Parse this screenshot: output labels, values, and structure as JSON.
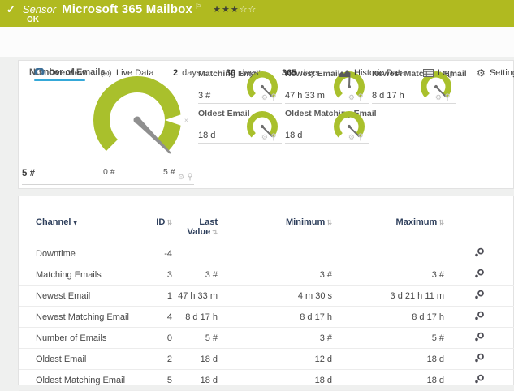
{
  "colors": {
    "header_green": "#b0ba20",
    "gauge_green": "#a9c02c",
    "active_tab_blue": "#35a8d8",
    "table_header_text": "#2e3f5c"
  },
  "icons": {
    "check": "✓",
    "flag": "⚐",
    "stars_filled": "★★★",
    "stars_empty": "☆☆",
    "gear": "⚙",
    "sort": "⇅",
    "sort_desc": "▾",
    "limit_marker": "×"
  },
  "header": {
    "kind_label": "Sensor",
    "title": "Microsoft 365 Mailbox",
    "status": "OK",
    "rating_filled_count": 3,
    "rating_total": 5
  },
  "tabs": {
    "overview": "Overview",
    "live_data": "Live Data",
    "d2_num": "2",
    "d2_label": "days",
    "d30_num": "30",
    "d30_label": "days",
    "d365_num": "365",
    "d365_label": "days",
    "historic": "Historic Data",
    "log": "Log",
    "settings": "Settings"
  },
  "overview": {
    "main_gauge": {
      "title": "Number of Emails",
      "value": "5 #",
      "scale_min": "0 #",
      "scale_max": "5 #",
      "needle_deg": 135
    },
    "gauges": [
      {
        "title": "Matching Emails",
        "value": "3 #",
        "needle_deg": 135
      },
      {
        "title": "Newest Email",
        "value": "47 h 33 m",
        "needle_deg": 2
      },
      {
        "title": "Newest Matching Email",
        "value": "8 d 17 h",
        "needle_deg": 135
      },
      {
        "title": "Oldest Email",
        "value": "18 d",
        "needle_deg": 135
      },
      {
        "title": "Oldest Matching Email",
        "value": "18 d",
        "needle_deg": 135
      }
    ]
  },
  "table": {
    "headers": {
      "channel": "Channel",
      "id": "ID",
      "last_line1": "Last",
      "last_line2": "Value",
      "min": "Minimum",
      "max": "Maximum"
    },
    "rows": [
      {
        "channel": "Downtime",
        "id": "-4",
        "last": "",
        "min": "",
        "max": ""
      },
      {
        "channel": "Matching Emails",
        "id": "3",
        "last": "3 #",
        "min": "3 #",
        "max": "3 #"
      },
      {
        "channel": "Newest Email",
        "id": "1",
        "last": "47 h 33 m",
        "min": "4 m 30 s",
        "max": "3 d 21 h 11 m"
      },
      {
        "channel": "Newest Matching Email",
        "id": "4",
        "last": "8 d 17 h",
        "min": "8 d 17 h",
        "max": "8 d 17 h"
      },
      {
        "channel": "Number of Emails",
        "id": "0",
        "last": "5 #",
        "min": "3 #",
        "max": "5 #"
      },
      {
        "channel": "Oldest Email",
        "id": "2",
        "last": "18 d",
        "min": "12 d",
        "max": "18 d"
      },
      {
        "channel": "Oldest Matching Email",
        "id": "5",
        "last": "18 d",
        "min": "18 d",
        "max": "18 d"
      }
    ]
  }
}
